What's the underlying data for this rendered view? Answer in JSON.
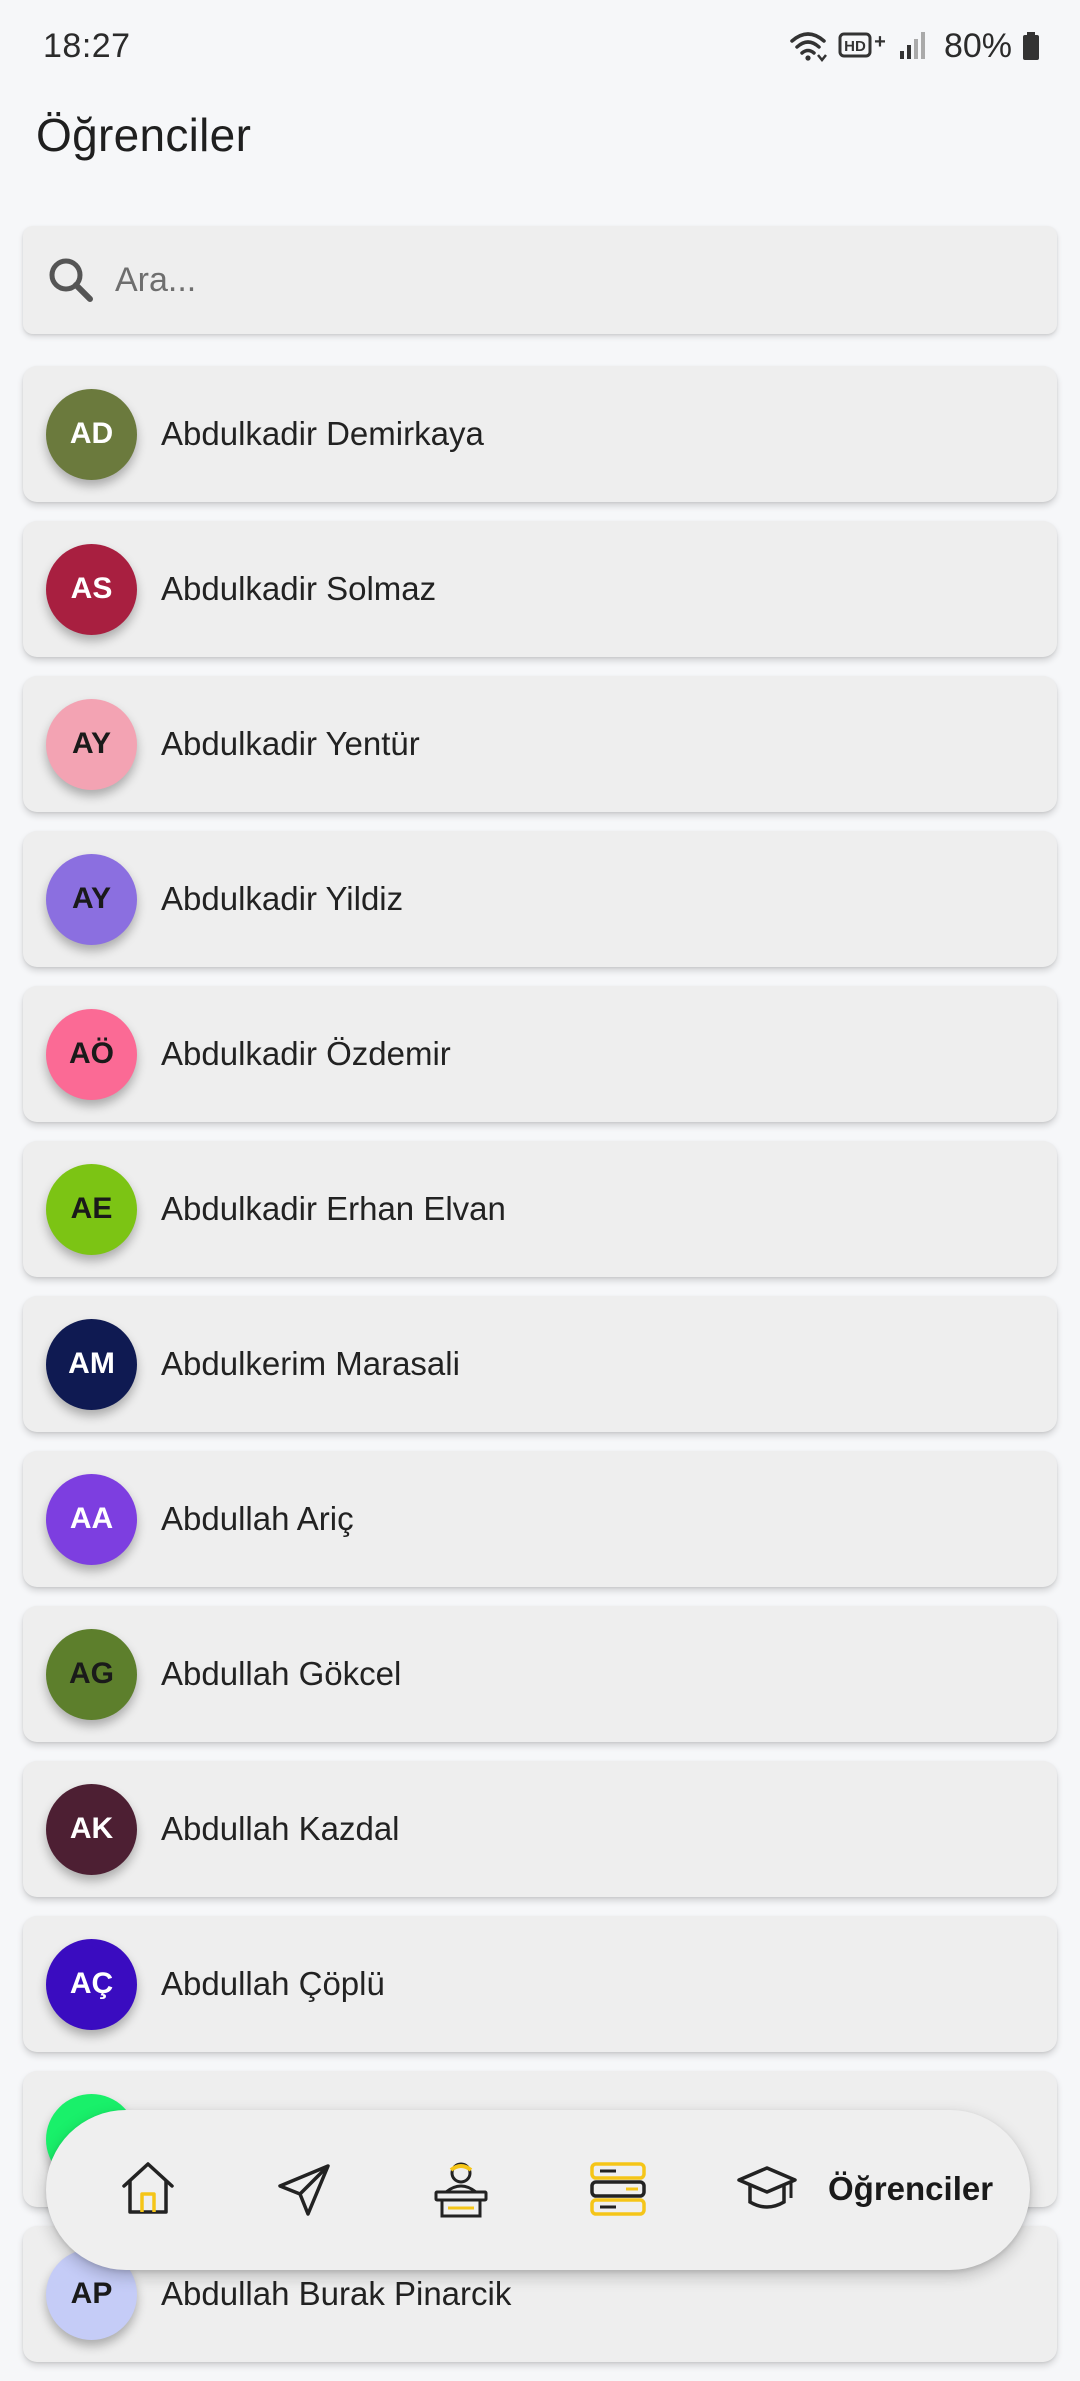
{
  "status_bar": {
    "time": "18:27",
    "network_label": "HD+",
    "battery": "80%"
  },
  "page": {
    "title": "Öğrenciler"
  },
  "search": {
    "placeholder": "Ara...",
    "value": ""
  },
  "students": [
    {
      "initials": "AD",
      "name": "Abdulkadir Demirkaya",
      "color": "#6b7a3d",
      "text_color": "#ffffff"
    },
    {
      "initials": "AS",
      "name": "Abdulkadir Solmaz",
      "color": "#a81f40",
      "text_color": "#ffffff"
    },
    {
      "initials": "AY",
      "name": "Abdulkadir Yentür",
      "color": "#f3a3b3",
      "text_color": "#1a1a1a"
    },
    {
      "initials": "AY",
      "name": "Abdulkadir Yildiz",
      "color": "#8b6fe0",
      "text_color": "#1a1a1a"
    },
    {
      "initials": "AÖ",
      "name": "Abdulkadir Özdemir",
      "color": "#fb6a95",
      "text_color": "#1a1a1a"
    },
    {
      "initials": "AE",
      "name": "Abdulkadir Erhan Elvan",
      "color": "#7cc414",
      "text_color": "#1a1a1a"
    },
    {
      "initials": "AM",
      "name": "Abdulkerim Marasali",
      "color": "#0f1a52",
      "text_color": "#ffffff"
    },
    {
      "initials": "AA",
      "name": "Abdullah Ariç",
      "color": "#7d3ee0",
      "text_color": "#ffffff"
    },
    {
      "initials": "AG",
      "name": "Abdullah Gökcel",
      "color": "#5d7f2c",
      "text_color": "#1a1a1a"
    },
    {
      "initials": "AK",
      "name": "Abdullah Kazdal",
      "color": "#4d1f33",
      "text_color": "#ffffff"
    },
    {
      "initials": "AÇ",
      "name": "Abdullah Çöplü",
      "color": "#3a0cc0",
      "text_color": "#ffffff"
    },
    {
      "initials": "",
      "name": "",
      "color": "#19f06a",
      "text_color": "#1a1a1a"
    },
    {
      "initials": "AP",
      "name": "Abdullah Burak Pinarcik",
      "color": "#c5ccf7",
      "text_color": "#1a1a1a"
    }
  ],
  "bottom_nav": {
    "items": [
      {
        "icon": "home-icon",
        "label": ""
      },
      {
        "icon": "send-icon",
        "label": ""
      },
      {
        "icon": "teacher-icon",
        "label": ""
      },
      {
        "icon": "books-icon",
        "label": ""
      },
      {
        "icon": "graduation-cap-icon",
        "label": "Öğrenciler"
      }
    ],
    "accent_color": "#f5c518"
  }
}
